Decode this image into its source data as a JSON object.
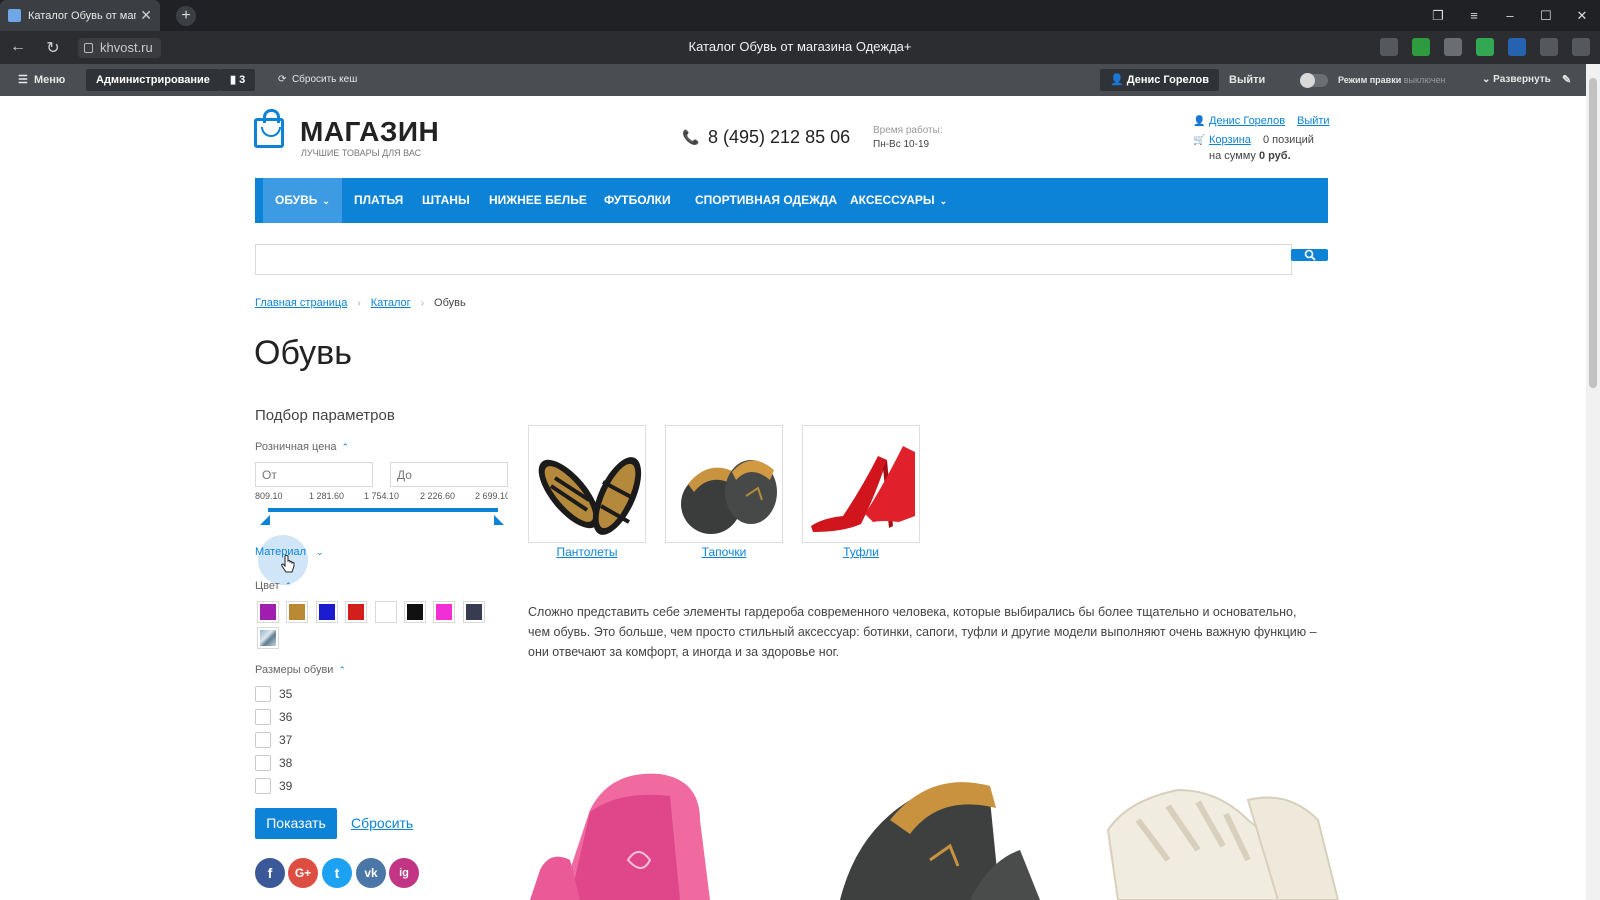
{
  "browser": {
    "tab_title": "Каталог Обувь от магазина Одежда+",
    "url": "khvost.ru",
    "page_title": "Каталог Обувь от магазина Одежда+"
  },
  "admin": {
    "menu_label": "Меню",
    "admin_label": "Администрирование",
    "counter": "3",
    "clear_cache": "Сбросить кеш",
    "user": "Денис Горелов",
    "logout": "Выйти",
    "edit_mode": "Режим правки",
    "edit_mode_state": "выключен",
    "expand": "Развернуть"
  },
  "header": {
    "logo_name": "МАГАЗИН",
    "logo_tagline": "ЛУЧШИЕ ТОВАРЫ ДЛЯ ВАС",
    "phone": "8 (495) 212 85 06",
    "hours_label": "Время работы:",
    "hours": "Пн-Вс 10-19",
    "user_name": "Денис Горелов",
    "logout": "Выйти",
    "cart_label": "Корзина",
    "cart_count": "0 позиций",
    "cart_sum_prefix": "на сумму",
    "cart_sum": "0 руб."
  },
  "nav": {
    "items": [
      {
        "label": "ОБУВЬ",
        "dropdown": true,
        "active": true
      },
      {
        "label": "ПЛАТЬЯ"
      },
      {
        "label": "ШТАНЫ"
      },
      {
        "label": "НИЖНЕЕ БЕЛЬЕ"
      },
      {
        "label": "ФУТБОЛКИ"
      },
      {
        "label": "СПОРТИВНАЯ ОДЕЖДА"
      },
      {
        "label": "АКСЕССУАРЫ",
        "dropdown": true
      }
    ]
  },
  "search": {
    "placeholder": ""
  },
  "breadcrumb": {
    "home": "Главная страница",
    "catalog": "Каталог",
    "current": "Обувь"
  },
  "page": {
    "title": "Обувь"
  },
  "filter": {
    "title": "Подбор параметров",
    "price_label": "Розничная цена",
    "from_placeholder": "От",
    "to_placeholder": "До",
    "ticks": [
      "809.10",
      "1 281.60",
      "1 754.10",
      "2 226.60",
      "2 699.10"
    ],
    "material_label": "Материал",
    "color_label": "Цвет",
    "colors": [
      "#a01db0",
      "#b98a33",
      "#1b1bd0",
      "#d31e1e",
      "#ffffff",
      "#111111",
      "#f22fd4",
      "#383c52",
      "pattern"
    ],
    "sizes_label": "Размеры обуви",
    "sizes": [
      "35",
      "36",
      "37",
      "38",
      "39"
    ],
    "show_button": "Показать",
    "reset_link": "Сбросить"
  },
  "social": {
    "facebook": "f",
    "google": "G+",
    "twitter": "t",
    "vk": "vk",
    "instagram": "ig",
    "colors": {
      "facebook": "#3b5998",
      "google": "#dc4e41",
      "twitter": "#1da1f2",
      "vk": "#4a76a8",
      "instagram": "#c13584"
    }
  },
  "subcategories": [
    {
      "label": "Пантолеты"
    },
    {
      "label": "Тапочки"
    },
    {
      "label": "Туфли"
    }
  ],
  "description": "Сложно представить себе элементы гардероба современного человека, которые выбирались бы более тщательно и основательно, чем обувь. Это больше, чем просто стильный аксессуар: ботинки, сапоги, туфли и другие модели выполняют очень важную функцию – они отвечают за комфорт, а иногда и за здоровье ног.",
  "accent_color": "#0d83d8"
}
